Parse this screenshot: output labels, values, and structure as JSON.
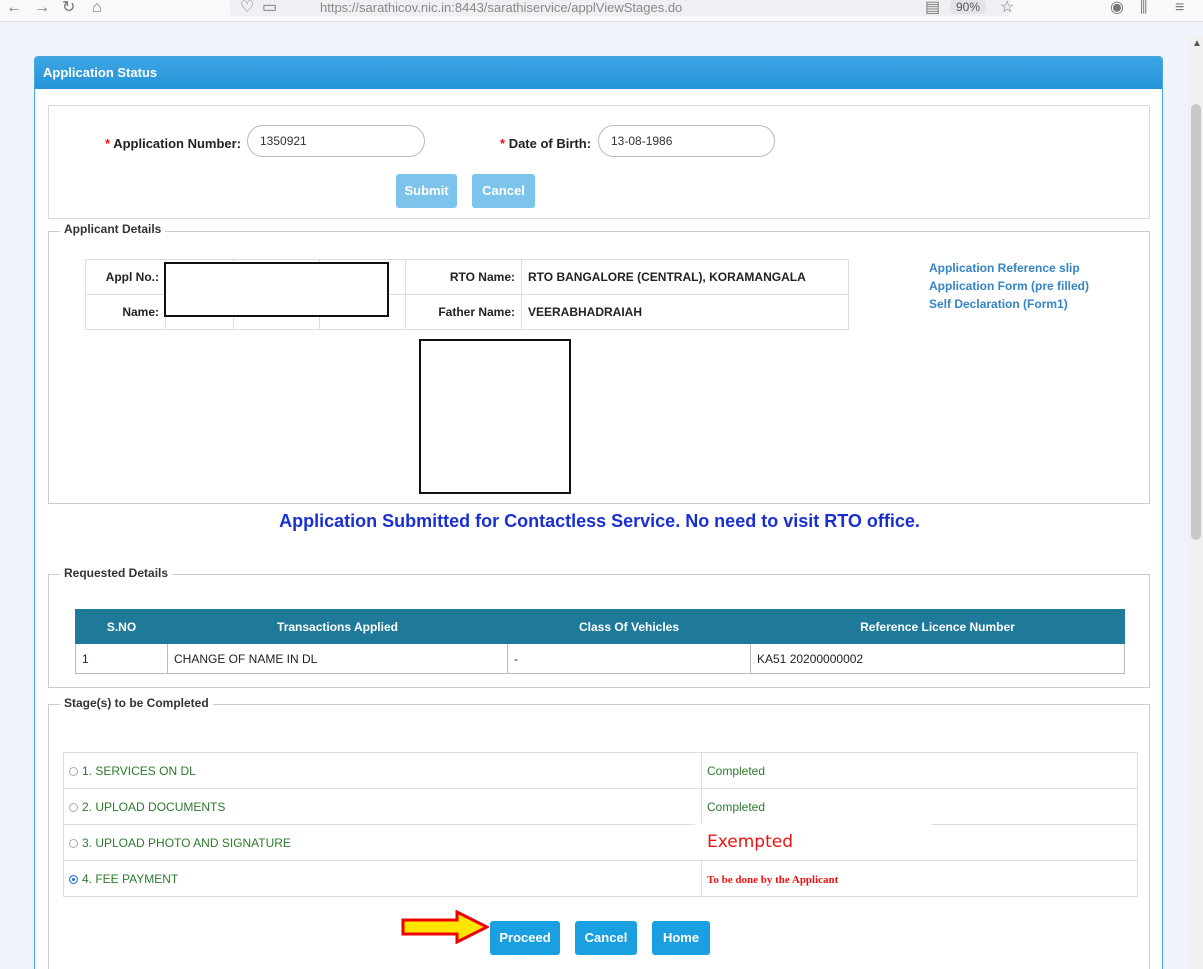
{
  "browser": {
    "url": "https://sarathicov.nic.in:8443/sarathiservice/applViewStages.do",
    "zoom": "90%"
  },
  "panel": {
    "title": "Application Status"
  },
  "search": {
    "app_number_label": "Application Number:",
    "app_number_value": "1350921",
    "dob_label": "Date of Birth:",
    "dob_value": "13-08-1986",
    "required_mark": "*",
    "submit_label": "Submit",
    "cancel_label": "Cancel"
  },
  "applicant": {
    "legend": "Applicant Details",
    "appl_no_label": "Appl No.:",
    "name_label": "Name:",
    "rto_label": "RTO Name:",
    "rto_value": "RTO BANGALORE (CENTRAL), KORAMANGALA",
    "father_label": "Father Name:",
    "father_value": "VEERABHADRAIAH",
    "links": [
      "Application Reference slip",
      "Application Form (pre filled)",
      "Self Declaration (Form1)"
    ]
  },
  "notice": "Application Submitted for Contactless Service. No need to visit RTO office.",
  "requested": {
    "legend": "Requested Details",
    "headers": [
      "S.NO",
      "Transactions Applied",
      "Class Of Vehicles",
      "Reference Licence Number"
    ],
    "rows": [
      {
        "sno": "1",
        "transaction": "CHANGE OF NAME IN DL",
        "cov": "-",
        "ref_licence": "KA51 20200000002"
      }
    ]
  },
  "stages": {
    "legend": "Stage(s) to be Completed",
    "items": [
      {
        "label": "1.  SERVICES ON DL",
        "status": "Completed",
        "selected": false
      },
      {
        "label": "2.  UPLOAD DOCUMENTS",
        "status": "Completed",
        "selected": false
      },
      {
        "label": "3.  UPLOAD PHOTO AND SIGNATURE",
        "status": "",
        "selected": false
      },
      {
        "label": "4.  FEE PAYMENT",
        "status": "To be done by the Applicant",
        "selected": true
      }
    ],
    "exempted_note": "Exempted"
  },
  "actions": {
    "proceed": "Proceed",
    "cancel": "Cancel",
    "home": "Home"
  },
  "colors": {
    "header_blue": "#2494d8",
    "table_header": "#1f7a99",
    "notice_blue": "#1a2fd0",
    "alert_red": "#e11",
    "arrow_fill": "#ffe600",
    "arrow_border": "#e00"
  }
}
